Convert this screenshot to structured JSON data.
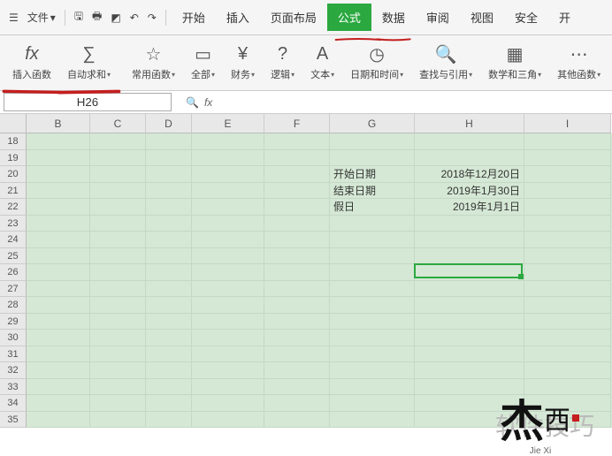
{
  "topbar": {
    "file": "文件",
    "dd": "▾"
  },
  "menu": {
    "start": "开始",
    "insert": "插入",
    "page": "页面布局",
    "formula": "公式",
    "data": "数据",
    "review": "审阅",
    "view": "视图",
    "safe": "安全",
    "open": "开"
  },
  "ribbon": {
    "fx": "插入函数",
    "sum": "自动求和",
    "common": "常用函数",
    "all": "全部",
    "finance": "财务",
    "logic": "逻辑",
    "text": "文本",
    "datetime": "日期和时间",
    "lookup": "查找与引用",
    "math": "数学和三角",
    "other": "其他函数"
  },
  "namebox": "H26",
  "columns": [
    "B",
    "C",
    "D",
    "E",
    "F",
    "G",
    "H",
    "I"
  ],
  "rows": [
    "18",
    "19",
    "20",
    "21",
    "22",
    "23",
    "24",
    "25",
    "26",
    "27",
    "28",
    "29",
    "30",
    "31",
    "32",
    "33",
    "34",
    "35"
  ],
  "cells": {
    "G20": "开始日期",
    "H20": "2018年12月20日",
    "G21": "结束日期",
    "H21": "2019年1月30日",
    "G22": "假日",
    "H22": "2019年1月1日"
  },
  "selection": {
    "row_idx": 8,
    "col_idx": 6
  }
}
